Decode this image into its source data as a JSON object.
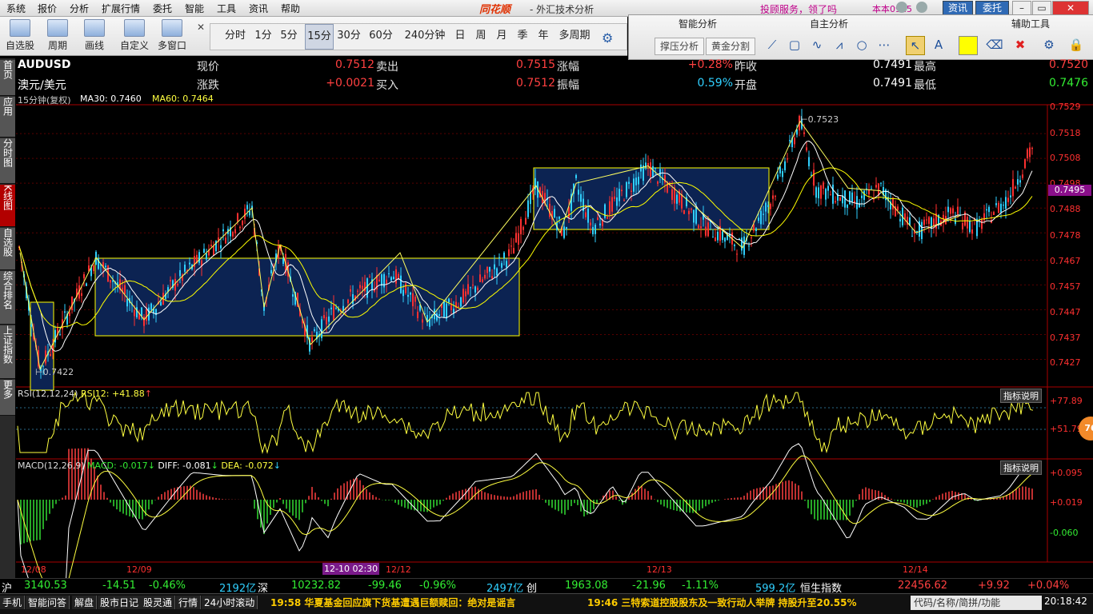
{
  "menu": {
    "items": [
      "系统",
      "报价",
      "分析",
      "扩展行情",
      "委托",
      "智能",
      "工具",
      "资讯",
      "帮助"
    ],
    "brand": "同花顺",
    "app_title": "- 外汇技术分析",
    "service_link": "投顾服务，领了吗",
    "version": "本本0915",
    "zixun": "资讯",
    "weituo": "委托"
  },
  "toolbar": {
    "buttons": [
      "自选股",
      "周期",
      "画线",
      "自定义",
      "多窗口"
    ],
    "periods": [
      "分时",
      "1分",
      "5分",
      "15分",
      "30分",
      "60分",
      "240分钟",
      "日",
      "周",
      "月",
      "季",
      "年",
      "多周期"
    ],
    "active_period": "15分"
  },
  "analysis_panel": {
    "headers": [
      "智能分析",
      "自主分析",
      "辅助工具"
    ],
    "buttons": [
      "撑压分析",
      "黄金分割"
    ],
    "accent": "#ffff00"
  },
  "left_tabs": [
    "首页",
    "应用",
    "分时图",
    "K线图",
    "自选股",
    "综合排名",
    "上证指数",
    "更多"
  ],
  "left_tabs_active": "K线图",
  "quote": {
    "symbol": "AUDUSD",
    "name": "澳元/美元",
    "row1": [
      {
        "label": "现价",
        "value": "0.7512",
        "color": "red"
      },
      {
        "label": "卖出",
        "value": "0.7515",
        "color": "red"
      },
      {
        "label": "涨幅",
        "value": "+0.28%",
        "color": "red"
      },
      {
        "label": "昨收",
        "value": "0.7491",
        "color": "wht"
      },
      {
        "label": "最高",
        "value": "0.7520",
        "color": "red"
      }
    ],
    "row2": [
      {
        "label": "涨跌",
        "value": "+0.0021",
        "color": "red"
      },
      {
        "label": "买入",
        "value": "0.7512",
        "color": "red"
      },
      {
        "label": "振幅",
        "value": "0.59%",
        "color": "cyan"
      },
      {
        "label": "开盘",
        "value": "0.7491",
        "color": "wht"
      },
      {
        "label": "最低",
        "value": "0.7476",
        "color": "green"
      }
    ],
    "ma_line": {
      "period": "15分钟(复权)",
      "ma30": "MA30: 0.7460",
      "ma60": "MA60: 0.7464"
    }
  },
  "price_axis": [
    "0.7529",
    "0.7518",
    "0.7508",
    "0.7498",
    "0.7488",
    "0.7478",
    "0.7467",
    "0.7457",
    "0.7447",
    "0.7437",
    "0.7427"
  ],
  "price_tag": "0.7495",
  "annotations": {
    "high": "0.7523",
    "low": "0.7422"
  },
  "rsi": {
    "label": "RSI(12,12,24)",
    "value": "RSI12: +41.88",
    "axis": [
      "+77.89",
      "+51.79"
    ],
    "btn": "指标说明",
    "badge": "76"
  },
  "macd": {
    "label": "MACD(12,26,9)",
    "macd": "MACD: -0.017",
    "diff": "DIFF: -0.081",
    "dea": "DEA: -0.072",
    "axis": [
      "+0.095",
      "+0.019",
      "-0.060"
    ],
    "btn": "指标说明"
  },
  "x_axis": [
    "12/08",
    "12/09",
    "12-10 02:30",
    "12/12",
    "12/13",
    "12/14"
  ],
  "chart_data": {
    "type": "candlestick",
    "symbol": "AUDUSD",
    "interval": "15分",
    "ylim": [
      0.7422,
      0.7529
    ],
    "annotations": [
      {
        "label": "0.7523",
        "value": 0.7523
      },
      {
        "label": "0.7422",
        "value": 0.7422
      }
    ],
    "ma30": 0.746,
    "ma60": 0.7464,
    "last": 0.7495
  },
  "index_bar": [
    {
      "text": "沪",
      "color": "wht"
    },
    {
      "text": "3140.53",
      "color": "green"
    },
    {
      "text": "-14.51",
      "color": "green"
    },
    {
      "text": "-0.46%",
      "color": "green"
    },
    {
      "text": "2192亿",
      "color": "cyan"
    },
    {
      "text": "深",
      "color": "wht"
    },
    {
      "text": "10232.82",
      "color": "green"
    },
    {
      "text": "-99.46",
      "color": "green"
    },
    {
      "text": "-0.96%",
      "color": "green"
    },
    {
      "text": "2497亿",
      "color": "cyan"
    },
    {
      "text": "创",
      "color": "wht"
    },
    {
      "text": "1963.08",
      "color": "green"
    },
    {
      "text": "-21.96",
      "color": "green"
    },
    {
      "text": "-1.11%",
      "color": "green"
    },
    {
      "text": "599.2亿",
      "color": "cyan"
    },
    {
      "text": "恒生指数",
      "color": "wht"
    },
    {
      "text": "22456.62",
      "color": "red"
    },
    {
      "text": "+9.92",
      "color": "red"
    },
    {
      "text": "+0.04%",
      "color": "red"
    }
  ],
  "status_bar": {
    "tabs": [
      "手机",
      "智能问答",
      "解盘",
      "股市日记",
      "股灵通",
      "行情",
      "24小时滚动"
    ],
    "news1": "19:58 华夏基金回应旗下货基遭遇巨额赎回：绝对是谣言",
    "news2": "19:46 三特索道控股股东及一致行动人举牌 持股升至20.55%",
    "search": "代码/名称/简拼/功能",
    "time": "20:18:42"
  },
  "colors": {
    "up": "#ff3030",
    "down": "#30d0ff",
    "box": "#0c2352",
    "boxedge": "#ffff00",
    "ma30": "#ffffff",
    "ma60": "#ffff00"
  }
}
